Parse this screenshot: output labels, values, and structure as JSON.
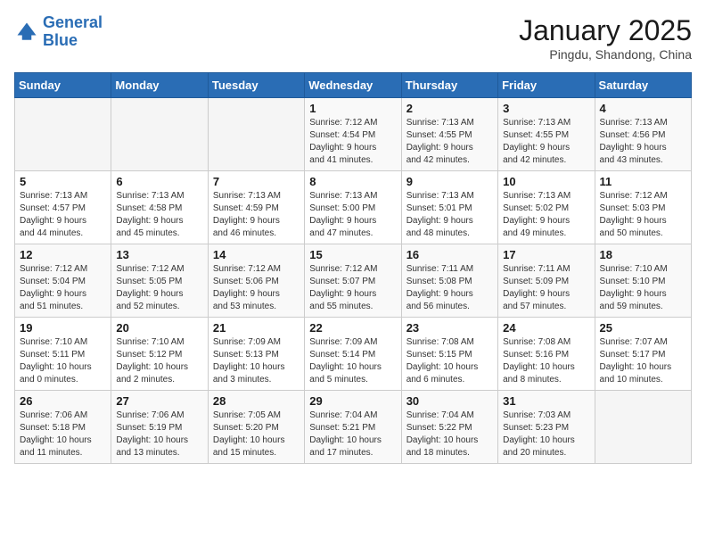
{
  "header": {
    "logo_line1": "General",
    "logo_line2": "Blue",
    "month": "January 2025",
    "location": "Pingdu, Shandong, China"
  },
  "weekdays": [
    "Sunday",
    "Monday",
    "Tuesday",
    "Wednesday",
    "Thursday",
    "Friday",
    "Saturday"
  ],
  "weeks": [
    [
      {
        "day": "",
        "info": ""
      },
      {
        "day": "",
        "info": ""
      },
      {
        "day": "",
        "info": ""
      },
      {
        "day": "1",
        "info": "Sunrise: 7:12 AM\nSunset: 4:54 PM\nDaylight: 9 hours\nand 41 minutes."
      },
      {
        "day": "2",
        "info": "Sunrise: 7:13 AM\nSunset: 4:55 PM\nDaylight: 9 hours\nand 42 minutes."
      },
      {
        "day": "3",
        "info": "Sunrise: 7:13 AM\nSunset: 4:55 PM\nDaylight: 9 hours\nand 42 minutes."
      },
      {
        "day": "4",
        "info": "Sunrise: 7:13 AM\nSunset: 4:56 PM\nDaylight: 9 hours\nand 43 minutes."
      }
    ],
    [
      {
        "day": "5",
        "info": "Sunrise: 7:13 AM\nSunset: 4:57 PM\nDaylight: 9 hours\nand 44 minutes."
      },
      {
        "day": "6",
        "info": "Sunrise: 7:13 AM\nSunset: 4:58 PM\nDaylight: 9 hours\nand 45 minutes."
      },
      {
        "day": "7",
        "info": "Sunrise: 7:13 AM\nSunset: 4:59 PM\nDaylight: 9 hours\nand 46 minutes."
      },
      {
        "day": "8",
        "info": "Sunrise: 7:13 AM\nSunset: 5:00 PM\nDaylight: 9 hours\nand 47 minutes."
      },
      {
        "day": "9",
        "info": "Sunrise: 7:13 AM\nSunset: 5:01 PM\nDaylight: 9 hours\nand 48 minutes."
      },
      {
        "day": "10",
        "info": "Sunrise: 7:13 AM\nSunset: 5:02 PM\nDaylight: 9 hours\nand 49 minutes."
      },
      {
        "day": "11",
        "info": "Sunrise: 7:12 AM\nSunset: 5:03 PM\nDaylight: 9 hours\nand 50 minutes."
      }
    ],
    [
      {
        "day": "12",
        "info": "Sunrise: 7:12 AM\nSunset: 5:04 PM\nDaylight: 9 hours\nand 51 minutes."
      },
      {
        "day": "13",
        "info": "Sunrise: 7:12 AM\nSunset: 5:05 PM\nDaylight: 9 hours\nand 52 minutes."
      },
      {
        "day": "14",
        "info": "Sunrise: 7:12 AM\nSunset: 5:06 PM\nDaylight: 9 hours\nand 53 minutes."
      },
      {
        "day": "15",
        "info": "Sunrise: 7:12 AM\nSunset: 5:07 PM\nDaylight: 9 hours\nand 55 minutes."
      },
      {
        "day": "16",
        "info": "Sunrise: 7:11 AM\nSunset: 5:08 PM\nDaylight: 9 hours\nand 56 minutes."
      },
      {
        "day": "17",
        "info": "Sunrise: 7:11 AM\nSunset: 5:09 PM\nDaylight: 9 hours\nand 57 minutes."
      },
      {
        "day": "18",
        "info": "Sunrise: 7:10 AM\nSunset: 5:10 PM\nDaylight: 9 hours\nand 59 minutes."
      }
    ],
    [
      {
        "day": "19",
        "info": "Sunrise: 7:10 AM\nSunset: 5:11 PM\nDaylight: 10 hours\nand 0 minutes."
      },
      {
        "day": "20",
        "info": "Sunrise: 7:10 AM\nSunset: 5:12 PM\nDaylight: 10 hours\nand 2 minutes."
      },
      {
        "day": "21",
        "info": "Sunrise: 7:09 AM\nSunset: 5:13 PM\nDaylight: 10 hours\nand 3 minutes."
      },
      {
        "day": "22",
        "info": "Sunrise: 7:09 AM\nSunset: 5:14 PM\nDaylight: 10 hours\nand 5 minutes."
      },
      {
        "day": "23",
        "info": "Sunrise: 7:08 AM\nSunset: 5:15 PM\nDaylight: 10 hours\nand 6 minutes."
      },
      {
        "day": "24",
        "info": "Sunrise: 7:08 AM\nSunset: 5:16 PM\nDaylight: 10 hours\nand 8 minutes."
      },
      {
        "day": "25",
        "info": "Sunrise: 7:07 AM\nSunset: 5:17 PM\nDaylight: 10 hours\nand 10 minutes."
      }
    ],
    [
      {
        "day": "26",
        "info": "Sunrise: 7:06 AM\nSunset: 5:18 PM\nDaylight: 10 hours\nand 11 minutes."
      },
      {
        "day": "27",
        "info": "Sunrise: 7:06 AM\nSunset: 5:19 PM\nDaylight: 10 hours\nand 13 minutes."
      },
      {
        "day": "28",
        "info": "Sunrise: 7:05 AM\nSunset: 5:20 PM\nDaylight: 10 hours\nand 15 minutes."
      },
      {
        "day": "29",
        "info": "Sunrise: 7:04 AM\nSunset: 5:21 PM\nDaylight: 10 hours\nand 17 minutes."
      },
      {
        "day": "30",
        "info": "Sunrise: 7:04 AM\nSunset: 5:22 PM\nDaylight: 10 hours\nand 18 minutes."
      },
      {
        "day": "31",
        "info": "Sunrise: 7:03 AM\nSunset: 5:23 PM\nDaylight: 10 hours\nand 20 minutes."
      },
      {
        "day": "",
        "info": ""
      }
    ]
  ]
}
